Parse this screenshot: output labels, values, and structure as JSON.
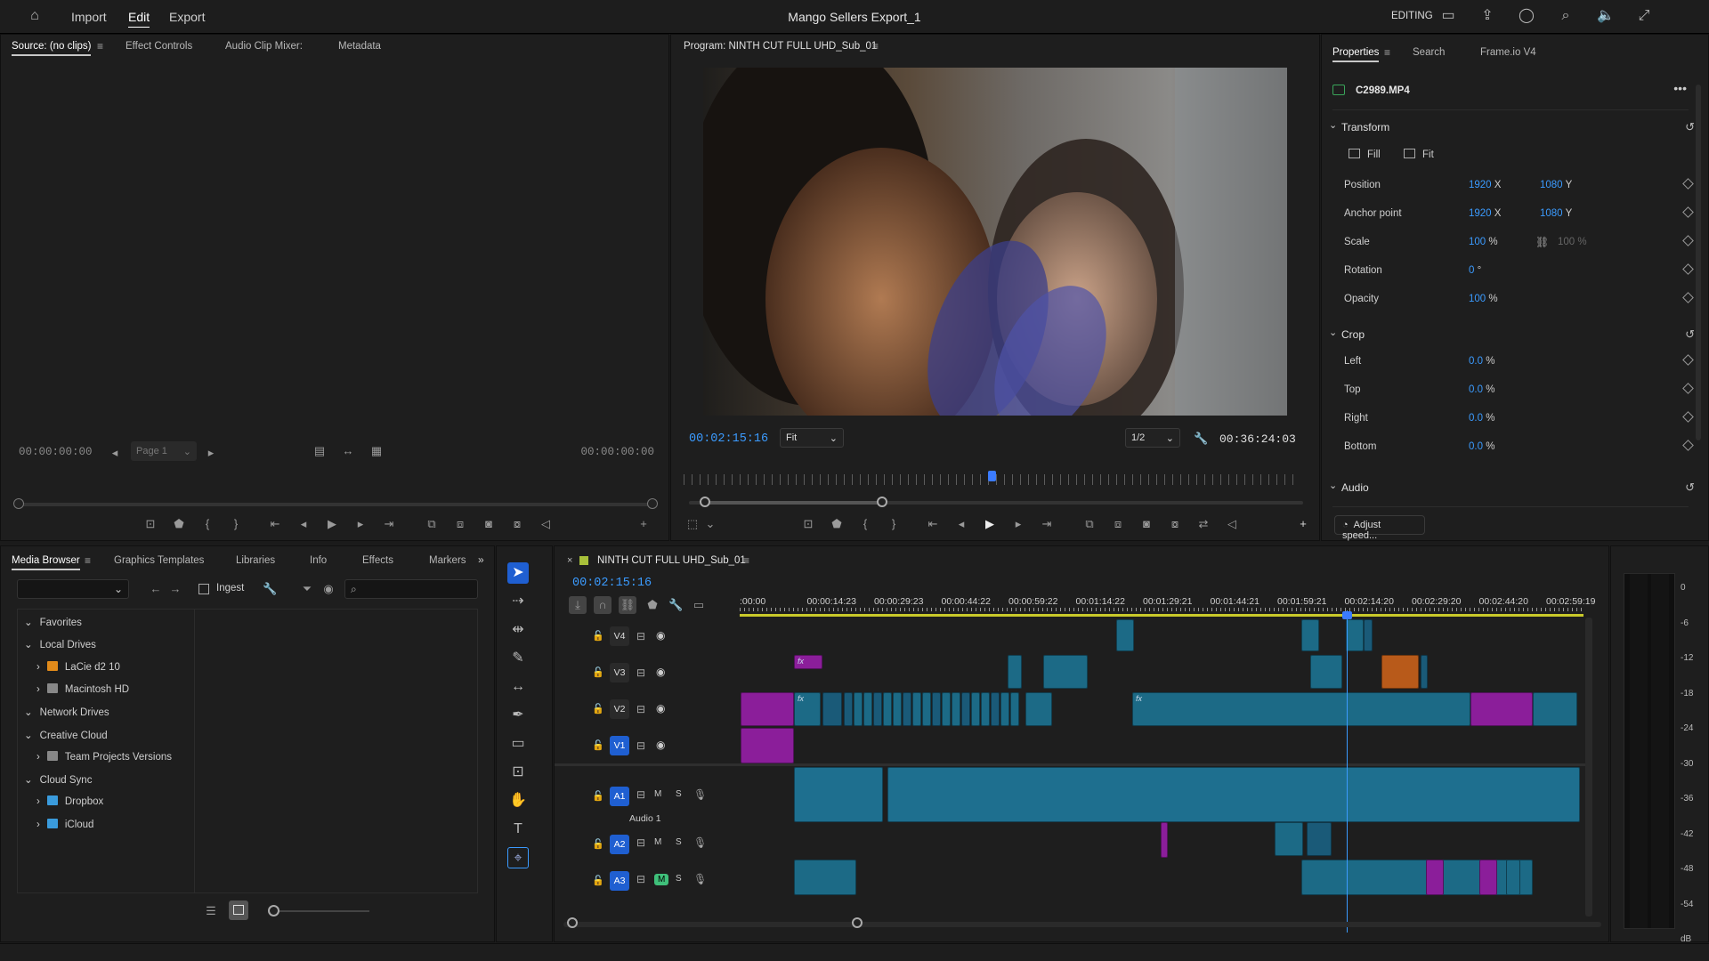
{
  "app": {
    "home_icon": "home-icon",
    "tabs": [
      "Import",
      "Edit",
      "Export"
    ],
    "active_tab": "Edit",
    "title": "Mango Sellers Export_1",
    "workspace": "EDITING",
    "right_icons": [
      "workspace-layout-icon",
      "share-icon",
      "progress-icon",
      "search-icon",
      "volume-icon",
      "fullscreen-icon"
    ]
  },
  "source_panel": {
    "tabs": [
      "Source: (no clips)",
      "Effect Controls",
      "Audio Clip Mixer:",
      "Metadata"
    ],
    "timecode_in": "00:00:00:00",
    "timecode_out": "00:00:00:00",
    "page": "Page 1"
  },
  "program_panel": {
    "title": "Program: NINTH CUT FULL UHD_Sub_01",
    "timecode": "00:02:15:16",
    "fit": "Fit",
    "resolution": "1/2",
    "duration": "00:36:24:03"
  },
  "properties_panel": {
    "tabs": [
      "Properties",
      "Search",
      "Frame.io V4"
    ],
    "clip_name": "C2989.MP4",
    "transform_label": "Transform",
    "fill_label": "Fill",
    "fit_label": "Fit",
    "transform_rows": [
      {
        "label": "Position",
        "v1": "1920",
        "u1": "X",
        "v2": "1080",
        "u2": "Y"
      },
      {
        "label": "Anchor point",
        "v1": "1920",
        "u1": "X",
        "v2": "1080",
        "u2": "Y"
      },
      {
        "label": "Scale",
        "v1": "100",
        "u1": "%",
        "v2": "100",
        "u2": "%"
      },
      {
        "label": "Rotation",
        "v1": "0",
        "u1": "°",
        "v2": "",
        "u2": ""
      },
      {
        "label": "Opacity",
        "v1": "100",
        "u1": "%",
        "v2": "",
        "u2": ""
      }
    ],
    "crop_label": "Crop",
    "crop_rows": [
      {
        "label": "Left",
        "v1": "0.0",
        "u1": "%"
      },
      {
        "label": "Top",
        "v1": "0.0",
        "u1": "%"
      },
      {
        "label": "Right",
        "v1": "0.0",
        "u1": "%"
      },
      {
        "label": "Bottom",
        "v1": "0.0",
        "u1": "%"
      }
    ],
    "audio_label": "Audio",
    "adjust_speed": "Adjust speed..."
  },
  "media_browser": {
    "tabs": [
      "Media Browser",
      "Graphics Templates",
      "Libraries",
      "Info",
      "Effects",
      "Markers"
    ],
    "ingest": "Ingest",
    "search_placeholder": "",
    "tree": [
      {
        "label": "Favorites",
        "level": 0,
        "expanded": true
      },
      {
        "label": "Local Drives",
        "level": 0,
        "expanded": true
      },
      {
        "label": "LaCie d2 10",
        "level": 1,
        "icon": "drive-orange-icon"
      },
      {
        "label": "Macintosh HD",
        "level": 1,
        "icon": "drive-icon"
      },
      {
        "label": "Network Drives",
        "level": 0,
        "expanded": true
      },
      {
        "label": "Creative Cloud",
        "level": 0,
        "expanded": true
      },
      {
        "label": "Team Projects Versions",
        "level": 1,
        "icon": "team-projects-icon"
      },
      {
        "label": "Cloud Sync",
        "level": 0,
        "expanded": true
      },
      {
        "label": "Dropbox",
        "level": 1,
        "icon": "folder-blue-icon"
      },
      {
        "label": "iCloud",
        "level": 1,
        "icon": "folder-blue-icon"
      }
    ]
  },
  "tools": [
    "selection-tool-icon",
    "track-select-tool-icon",
    "ripple-edit-tool-icon",
    "razor-tool-icon",
    "slip-tool-icon",
    "pen-tool-icon",
    "rectangle-tool-icon",
    "type-tool-icon",
    "hand-tool-icon",
    "text-tool-icon",
    "generative-extend-tool-icon"
  ],
  "timeline": {
    "sequence_name": "NINTH CUT FULL UHD_Sub_01",
    "timecode": "00:02:15:16",
    "ruler": [
      ":00:00",
      "00:00:14:23",
      "00:00:29:23",
      "00:00:44:22",
      "00:00:59:22",
      "00:01:14:22",
      "00:01:29:21",
      "00:01:44:21",
      "00:01:59:21",
      "00:02:14:20",
      "00:02:29:20",
      "00:02:44:20",
      "00:02:59:19"
    ],
    "tracks": [
      {
        "id": "V4",
        "type": "video"
      },
      {
        "id": "V3",
        "type": "video"
      },
      {
        "id": "V2",
        "type": "video"
      },
      {
        "id": "V1",
        "type": "video",
        "target": true
      },
      {
        "id": "A1",
        "type": "audio",
        "name": "Audio 1",
        "target": true
      },
      {
        "id": "A2",
        "type": "audio",
        "target": true
      },
      {
        "id": "A3",
        "type": "audio",
        "target": true,
        "mute": true
      }
    ],
    "mute_label": "M",
    "solo_label": "S",
    "fx_label": "fx"
  },
  "meter": {
    "scale": [
      "0",
      "-6",
      "-12",
      "-18",
      "-24",
      "-30",
      "-36",
      "-42",
      "-48",
      "-54",
      "dB"
    ]
  }
}
